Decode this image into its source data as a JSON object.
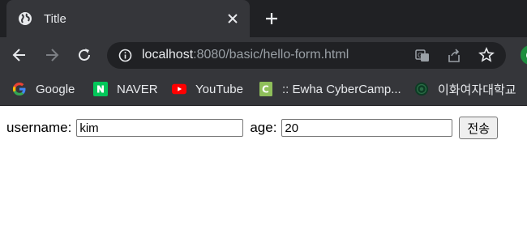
{
  "tab": {
    "title": "Title"
  },
  "address_bar": {
    "host": "localhost",
    "path": ":8080/basic/hello-form.html"
  },
  "profile": {
    "initial": "G"
  },
  "bookmarks": [
    {
      "label": "Google",
      "icon": "google-icon"
    },
    {
      "label": "NAVER",
      "icon": "naver-icon"
    },
    {
      "label": "YouTube",
      "icon": "youtube-icon"
    },
    {
      "label": ":: Ewha CyberCamp...",
      "icon": "cybercampus-icon"
    },
    {
      "label": "이화여자대학교",
      "icon": "ewha-icon"
    }
  ],
  "form": {
    "username_label": "username:",
    "username_value": "kim",
    "age_label": "age:",
    "age_value": "20",
    "submit_label": "전송"
  },
  "colors": {
    "tab_strip_bg": "#202124",
    "toolbar_bg": "#35363a",
    "text_light": "#e8eaed",
    "naver_green": "#03c75a",
    "youtube_red": "#ff0000"
  }
}
